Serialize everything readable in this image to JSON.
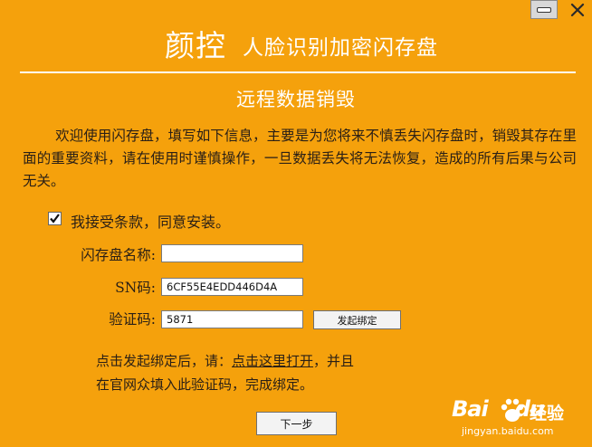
{
  "window": {
    "brand": "颜控",
    "product": "人脸识别加密闪存盘",
    "heading": "远程数据销毁",
    "icons": {
      "minimize": "minimize-icon",
      "close": "close-icon"
    }
  },
  "intro": {
    "text": "欢迎使用闪存盘，填写如下信息，主要是为您将来不慎丢失闪存盘时，销毁其存在里面的重要资料，请在使用时谨慎操作，一旦数据丢失将无法恢复，造成的所有后果与公司无关。"
  },
  "agreement": {
    "checked": true,
    "label": "我接受条款，同意安装。"
  },
  "form": {
    "name_label": "闪存盘名称:",
    "name_value": "",
    "sn_label": "SN码:",
    "sn_value": "6CF55E4EDD446D4A",
    "code_label": "验证码:",
    "code_value": "5871",
    "bind_button": "发起绑定"
  },
  "note": {
    "prefix": "点击发起绑定后，请：",
    "link": "点击这里打开",
    "suffix": "，并且",
    "line2": "在官网众填入此验证码，完成绑定。"
  },
  "next_button": "下一步",
  "watermark": {
    "brand": "Bai",
    "brand2": "du",
    "product": "经验",
    "url": "jingyan.baidu.com"
  },
  "colors": {
    "background": "#F5A10C",
    "text": "#2b2016",
    "title": "#ffffff"
  }
}
